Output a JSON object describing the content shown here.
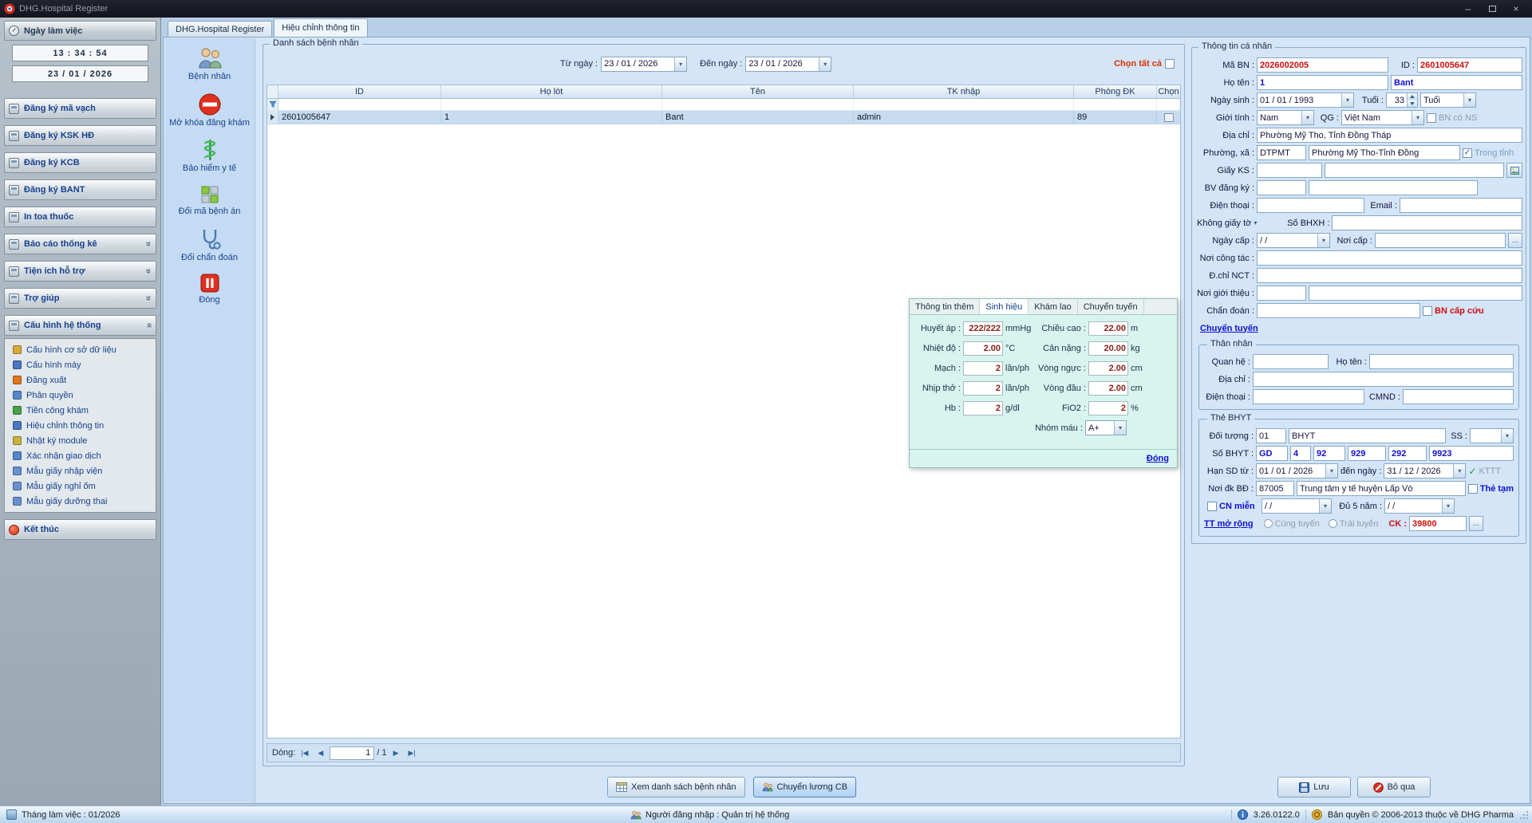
{
  "titlebar": {
    "title": "DHG.Hospital Register"
  },
  "icons": {
    "minimize": "–",
    "close": "×",
    "chevron_double": "»",
    "combo_arrow": "▾",
    "check": "✓",
    "nav_first": "|◀",
    "nav_prev": "◀",
    "nav_next": "▶",
    "nav_last": "▶|",
    "ellipsis": "..."
  },
  "sidebar": {
    "work_header": "Ngày làm việc",
    "clock": "13 : 34 : 54",
    "work_date": "23 / 01 / 2026",
    "buttons": [
      "Đăng ký mã vạch",
      "Đăng ký KSK HĐ",
      "Đăng ký KCB",
      "Đăng ký BANT",
      "In toa thuốc",
      "Báo cáo thống kê",
      "Tiện ích hỗ trợ",
      "Trợ giúp",
      "Cấu hình hệ thống"
    ],
    "config_items": [
      "Cấu hình cơ sở dữ liệu",
      "Cấu hình máy",
      "Đăng xuất",
      "Phân quyền",
      "Tiền công khám",
      "Hiệu chỉnh thông tin",
      "Nhật ký module",
      "Xác nhận giao dịch",
      "Mẫu giấy nhập viện",
      "Mẫu giấy nghỉ ốm",
      "Mẫu giấy dưỡng thai"
    ],
    "end_label": "Kết thúc"
  },
  "tabs": {
    "main": "DHG.Hospital Register",
    "edit": "Hiệu chỉnh thông tin"
  },
  "toolbar": {
    "items": [
      "Bệnh nhân",
      "Mở khóa đăng khám",
      "Bảo hiểm y tế",
      "Đổi mã bệnh án",
      "Đổi chẩn đoán",
      "Đóng"
    ]
  },
  "patient_list": {
    "group_title": "Danh sách bệnh nhân",
    "from_label": "Từ ngày :",
    "from_value": "23 / 01 / 2026",
    "to_label": "Đến  ngày :",
    "to_value": "23 / 01 / 2026",
    "select_all": "Chọn tất cả",
    "columns": [
      "ID",
      "Họ lót",
      "Tên",
      "TK nhập",
      "Phòng ĐK",
      "Chọn"
    ],
    "row": {
      "id": "2601005647",
      "ho_lot": "1",
      "ten": "Bant",
      "tk_nhap": "admin",
      "phong_dk": "89"
    },
    "pager_label": "Dòng:",
    "pager_value": "1",
    "pager_total": "/  1"
  },
  "vitals": {
    "tabs": [
      "Thông tin thêm",
      "Sinh hiệu",
      "Khám lao",
      "Chuyển tuyến"
    ],
    "left": [
      {
        "label": "Huyết áp :",
        "value": "222/222",
        "unit": "mmHg"
      },
      {
        "label": "Nhiệt độ :",
        "value": "2.00",
        "unit": "°C"
      },
      {
        "label": "Mạch :",
        "value": "2",
        "unit": "lần/ph"
      },
      {
        "label": "Nhịp thở :",
        "value": "2",
        "unit": "lần/ph"
      },
      {
        "label": "Hb :",
        "value": "2",
        "unit": "g/dl"
      }
    ],
    "right": [
      {
        "label": "Chiều cao :",
        "value": "22.00",
        "unit": "m"
      },
      {
        "label": "Cân nặng :",
        "value": "20.00",
        "unit": "kg"
      },
      {
        "label": "Vòng ngực :",
        "value": "2.00",
        "unit": "cm"
      },
      {
        "label": "Vòng đầu :",
        "value": "2.00",
        "unit": "cm"
      },
      {
        "label": "FiO2 :",
        "value": "2",
        "unit": "%"
      }
    ],
    "blood_label": "Nhóm máu :",
    "blood_value": "A+",
    "close_link": "Đóng"
  },
  "footer_buttons": {
    "view_list": "Xem danh sách bệnh nhân",
    "transfer": "Chuyển lương CB"
  },
  "info": {
    "group_title": "Thông tin cá nhân",
    "ma_bn_label": "Mã BN :",
    "ma_bn": "2026002005",
    "id_label": "ID :",
    "id": "2601005647",
    "ho_ten_label": "Họ tên :",
    "ho_lot": "1",
    "ten": "Bant",
    "ngay_sinh_label": "Ngày sinh :",
    "ngay_sinh": "01 / 01 / 1993",
    "tuoi_label": "Tuổi :",
    "tuoi": "33",
    "tuoi_unit": "Tuổi",
    "gioi_tinh_label": "Giới tính :",
    "gioi_tinh": "Nam",
    "qg_label": "QG :",
    "qg": "Việt Nam",
    "bn_co_ns": "BN có NS",
    "dia_chi_label": "Địa chỉ :",
    "dia_chi": "Phường Mỹ Tho, Tỉnh Đồng Tháp",
    "phuong_xa_label": "Phường, xã :",
    "phuong_code": "DTPMT",
    "phuong_name": "Phường Mỹ Tho-Tỉnh Đồng",
    "trong_tinh": "Trong tỉnh",
    "giay_ks_label": "Giấy KS :",
    "bv_dang_ky_label": "BV đăng ký :",
    "dien_thoai_label": "Điện thoại :",
    "email_label": "Email :",
    "khong_giay_to": "Không giấy tờ",
    "so_bhxh_label": "Số BHXH :",
    "ngay_cap_label": "Ngày cấp :",
    "ngay_cap": "/    /",
    "noi_cap_label": "Nơi cấp :",
    "noi_cong_tac_label": "Nơi công tác :",
    "d_chi_nct_label": "Đ.chỉ NCT :",
    "noi_gioi_thieu_label": "Nơi giới thiệu :",
    "chan_doan_label": "Chẩn đoán :",
    "bn_cap_cuu": "BN cấp cứu",
    "chuyen_tuyen_link": "Chuyển tuyến"
  },
  "relative": {
    "group_title": "Thân nhân",
    "quan_he_label": "Quan hệ :",
    "ho_ten_label": "Họ tên :",
    "dia_chi_label": "Địa chỉ :",
    "dien_thoai_label": "Điện thoại :",
    "cmnd_label": "CMND :"
  },
  "bhyt": {
    "group_title": "Thẻ BHYT",
    "doi_tuong_label": "Đối tượng :",
    "doi_tuong_code": "01",
    "doi_tuong_name": "BHYT",
    "ss_label": "SS :",
    "so_bhyt_label": "Số BHYT :",
    "seg": [
      "GD",
      "4",
      "92",
      "929",
      "292",
      "9923"
    ],
    "han_sd_label": "Hạn SD từ :",
    "han_tu": "01 / 01 / 2026",
    "den_ngay_label": "đến  ngày :",
    "han_den": "31 / 12 / 2026",
    "kttt": "KTTT",
    "noi_dk_label": "Nơi đk BĐ :",
    "noi_dk_code": "87005",
    "noi_dk_name": "Trung tâm y tế huyện Lấp Vò",
    "the_tam": "Thẻ tạm",
    "cn_mien": "CN miễn",
    "cn_mien_date": "/    /",
    "du5_label": "Đủ 5 năm :",
    "du5_date": "/    /",
    "tt_mo_rong": "TT mở rộng",
    "cung_tuyen": "Cùng tuyến",
    "trai_tuyen": "Trái tuyến",
    "ck_label": "CK :",
    "ck": "39800"
  },
  "actions": {
    "save": "Lưu",
    "skip": "Bỏ qua"
  },
  "statusbar": {
    "month": "Tháng làm việc : 01/2026",
    "user": "Người đăng nhập : Quản trị hệ thống",
    "version": "3.26.0122.0",
    "copyright": "Bản quyền © 2006-2013 thuộc về DHG Pharma"
  }
}
